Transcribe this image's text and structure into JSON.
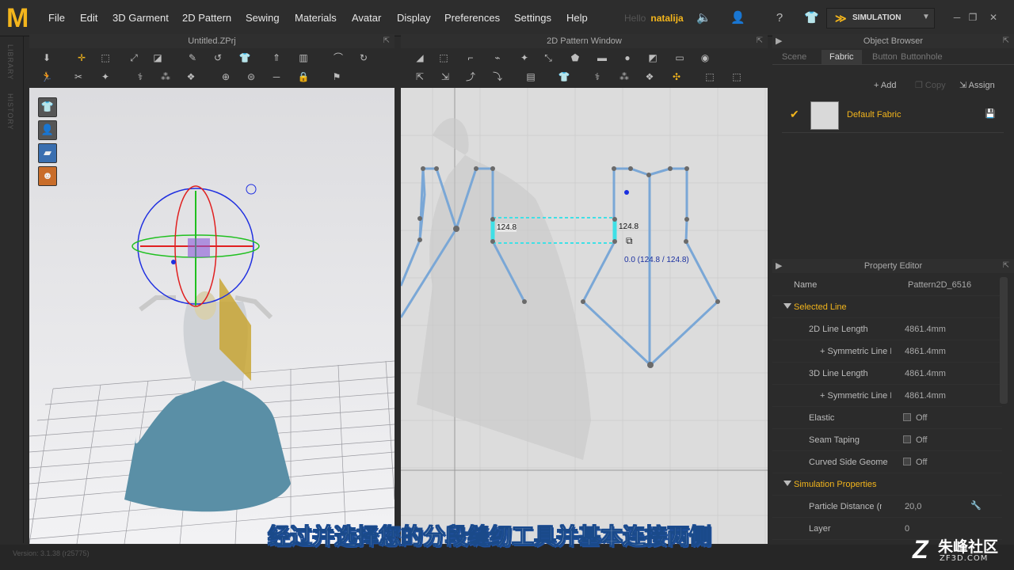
{
  "app": {
    "logo": "M",
    "menu": [
      "File",
      "Edit",
      "3D Garment",
      "2D Pattern",
      "Sewing",
      "Materials",
      "Avatar",
      "Display",
      "Preferences",
      "Settings",
      "Help"
    ],
    "user_greeting": "Hello",
    "user_name": "natalija",
    "simulation_label": "SIMULATION",
    "accent": "#f3b51c"
  },
  "left_strip": {
    "library": "LIBRARY",
    "history": "HISTORY"
  },
  "view3d": {
    "title": "Untitled.ZPrj"
  },
  "view2d": {
    "title": "2D Pattern Window",
    "label_left": "124.8",
    "label_right": "124.8",
    "label_blue": "0.0 (124.8 / 124.8)"
  },
  "object_browser": {
    "title": "Object Browser",
    "tabs": [
      "Scene",
      "Fabric",
      "Button",
      "Buttonhole"
    ],
    "active_tab": "Fabric",
    "add": "Add",
    "copy": "Copy",
    "assign": "Assign",
    "fabric_name": "Default Fabric"
  },
  "property_editor": {
    "title": "Property Editor",
    "name_label": "Name",
    "name_value": "Pattern2D_6516",
    "selected_line": "Selected Line",
    "rows": [
      {
        "label": "2D Line Length",
        "value": "4861.4mm"
      },
      {
        "label": "+ Symmetric Line Le",
        "value": "4861.4mm"
      },
      {
        "label": "3D Line Length",
        "value": "4861.4mm"
      },
      {
        "label": "+ Symmetric Line Le",
        "value": "4861.4mm"
      },
      {
        "label": "Elastic",
        "value": "Off"
      },
      {
        "label": "Seam Taping",
        "value": "Off"
      },
      {
        "label": "Curved Side Geome",
        "value": "Off"
      }
    ],
    "simulation_properties": "Simulation Properties",
    "particle_label": "Particle Distance (m",
    "particle_value": "20,0",
    "layer_label": "Layer",
    "layer_value": "0"
  },
  "status": {
    "version": "Version: 3.1.38 (r25775)"
  },
  "subtitle": "经过并选择您的分段缝纫工具并基本连接两侧",
  "watermark": {
    "main": "朱峰社区",
    "sub": "ZF3D.COM"
  }
}
